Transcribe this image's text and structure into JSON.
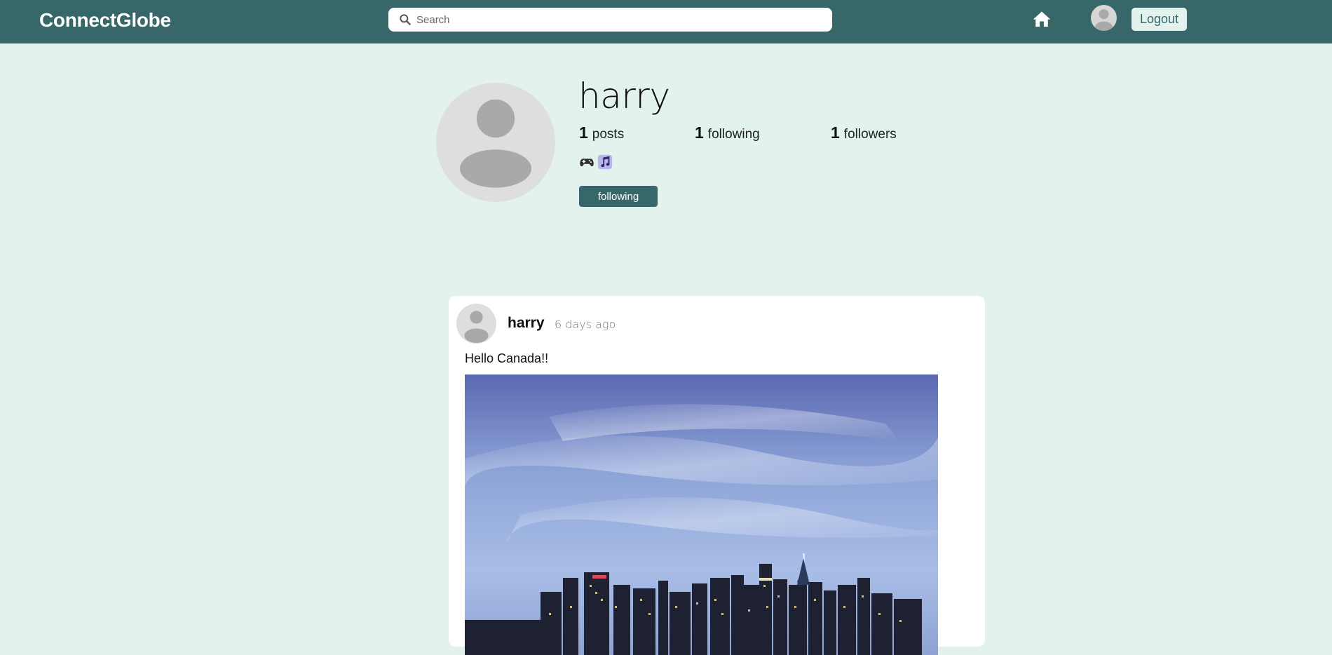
{
  "navbar": {
    "brand": "ConnectGlobe",
    "search_placeholder": "Search",
    "logout_label": "Logout",
    "colors": {
      "bar": "#376769",
      "page": "#e4f2ee"
    }
  },
  "profile": {
    "username": "harry",
    "stats": [
      {
        "count": "1",
        "label": "posts"
      },
      {
        "count": "1",
        "label": "following"
      },
      {
        "count": "1",
        "label": "followers"
      }
    ],
    "interests": [
      "gamepad-icon",
      "music-note-icon"
    ],
    "follow_button_label": "following"
  },
  "post": {
    "author": "harry",
    "time": "6 days ago",
    "text": "Hello Canada!!",
    "image": "city-skyline-at-dusk"
  }
}
